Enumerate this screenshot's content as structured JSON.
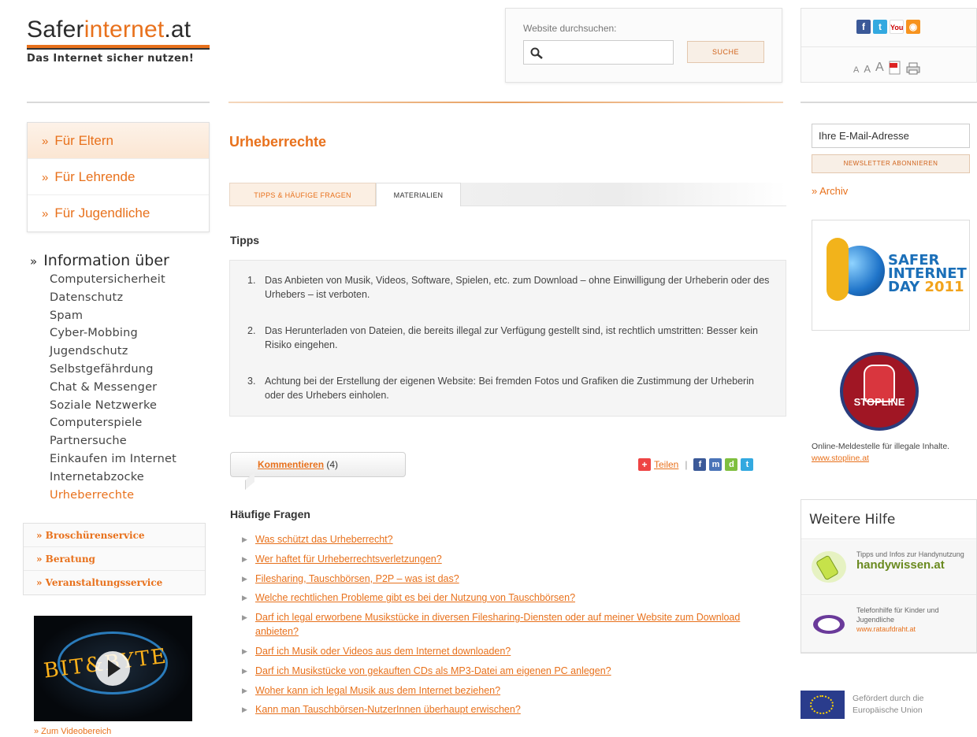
{
  "header": {
    "logo_part1": "Safer",
    "logo_part2": "internet",
    "logo_part3": ".at",
    "tagline": "Das Internet sicher nutzen!",
    "search_label": "Website durchsuchen:",
    "search_value": "",
    "search_button": "SUCHE",
    "social_icons": [
      "facebook-icon",
      "twitter-icon",
      "youtube-icon",
      "rss-icon"
    ],
    "font_sizes": [
      "A",
      "A",
      "A"
    ],
    "tool_icons": [
      "pdf-icon",
      "print-icon"
    ]
  },
  "sidebar": {
    "audience": [
      "Für Eltern",
      "Für Lehrende",
      "Für Jugendliche"
    ],
    "info_title": "Information über",
    "info_items": [
      "Computersicherheit",
      "Datenschutz",
      "Spam",
      "Cyber-Mobbing",
      "Jugendschutz",
      "Selbstgefährdung",
      "Chat & Messenger",
      "Soziale Netzwerke",
      "Computerspiele",
      "Partnersuche",
      "Einkaufen im Internet",
      "Internetabzocke",
      "Urheberrechte"
    ],
    "active_item": "Urheberrechte",
    "services": [
      "» Broschürenservice",
      "» Beratung",
      "» Veranstaltungsservice"
    ],
    "video_text": "BIT&BYTE",
    "video_link": "» Zum Videobereich"
  },
  "main": {
    "title": "Urheberrechte",
    "tabs": [
      "TIPPS & HÄUFIGE FRAGEN",
      "MATERIALIEN"
    ],
    "tipps_heading": "Tipps",
    "tipps": [
      {
        "n": "1.",
        "text": "Das Anbieten von Musik, Videos, Software, Spielen, etc. zum Download – ohne Einwilligung der Urheberin oder des Urhebers – ist verboten."
      },
      {
        "n": "2.",
        "text": "Das Herunterladen von Dateien, die bereits illegal zur Verfügung gestellt sind, ist rechtlich umstritten: Besser kein Risiko eingehen."
      },
      {
        "n": "3.",
        "text": "Achtung bei der Erstellung der eigenen Website: Bei fremden Fotos und Grafiken die Zustimmung der Urheberin oder des Urhebers einholen."
      }
    ],
    "comment_label": "Kommentieren",
    "comment_count": "(4)",
    "share_label": "Teilen",
    "share_sep": "|",
    "faq_heading": "Häufige Fragen",
    "faq": [
      "Was schützt das Urheberrecht?",
      "Wer haftet für Urheberrechtsverletzungen?",
      "Filesharing, Tauschbörsen, P2P – was ist das?",
      "Welche rechtlichen Probleme gibt es bei der Nutzung von Tauschbörsen?",
      "Darf ich legal erworbene Musikstücke in diversen Filesharing-Diensten oder auf meiner Website zum Download anbieten?",
      "Darf ich Musik oder Videos aus dem Internet downloaden?",
      "Darf ich Musikstücke von gekauften CDs als MP3-Datei am eigenen PC anlegen?",
      "Woher kann ich legal Musik aus dem Internet beziehen?",
      "Kann man Tauschbörsen-NutzerInnen überhaupt erwischen?"
    ]
  },
  "right": {
    "newsletter_value": "Ihre E-Mail-Adresse",
    "newsletter_button": "NEWSLETTER ABONNIEREN",
    "archiv": "» Archiv",
    "sid_line1": "SAFER",
    "sid_line2": "INTERNET",
    "sid_line3": "DAY",
    "sid_year": "2011",
    "stopline_word": "STOPLINE",
    "stopline_desc": "Online-Meldestelle für illegale Inhalte.",
    "stopline_link": "www.stopline.at",
    "help_title": "Weitere Hilfe",
    "help_items": [
      {
        "text": "Tipps und Infos zur Handynutzung",
        "brand": "handywissen.at"
      },
      {
        "text": "Telefonhilfe für Kinder und Jugendliche",
        "link": "www.rataufdraht.at"
      }
    ],
    "eu_text1": "Gefördert durch die",
    "eu_text2": "Europäische Union"
  },
  "colors": {
    "accent": "#e8711c",
    "text": "#333333"
  }
}
